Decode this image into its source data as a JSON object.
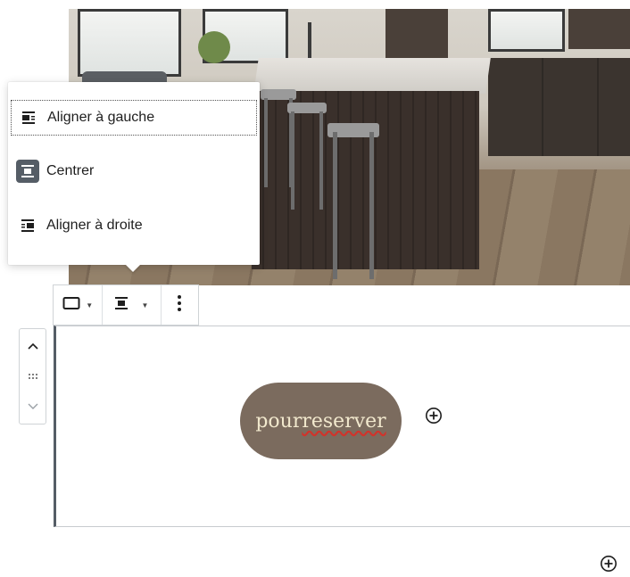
{
  "alignment_menu": {
    "items": [
      {
        "label": "Aligner à gauche",
        "icon": "align-left-icon"
      },
      {
        "label": "Centrer",
        "icon": "align-center-icon"
      },
      {
        "label": "Aligner à droite",
        "icon": "align-right-icon"
      }
    ],
    "active_index": 1,
    "focused_index": 0
  },
  "toolbar": {
    "block_type_icon": "button-block-icon",
    "align_icon": "align-center-icon",
    "more_icon": "more-vertical-icon"
  },
  "mover": {
    "up_icon": "chevron-up-icon",
    "drag_icon": "drag-handle-icon",
    "down_icon": "chevron-down-icon"
  },
  "button_block": {
    "text_plain": "pour ",
    "text_flagged": "reserver",
    "background": "#7b6b5e",
    "text_color": "#f1e8cd"
  },
  "inserters": {
    "inline_icon": "plus-circle-icon",
    "bottom_icon": "plus-circle-icon"
  },
  "colors": {
    "active_icon_bg": "#555d66",
    "block_border": "#555d66",
    "spellcheck": "#d0332b"
  }
}
